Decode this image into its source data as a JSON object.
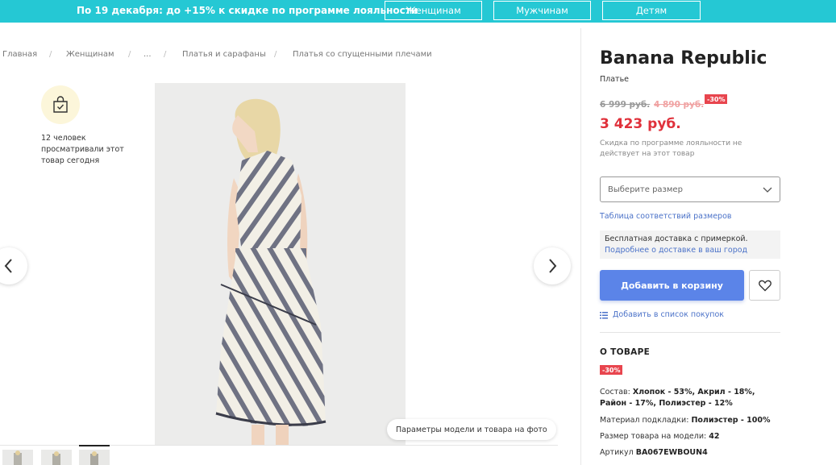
{
  "banner": {
    "promo": "По 19 декабря: до +15% к скидке по программе лояльности",
    "links": [
      "Женщинам",
      "Мужчинам",
      "Детям"
    ],
    "color": "#25c8d4"
  },
  "breadcrumb": [
    "Главная",
    "Женщинам",
    "...",
    "Платья и сарафаны",
    "Платья со спущенными плечами"
  ],
  "viewers": {
    "icon": "shopping-bag-check-icon",
    "text": "12 человек просматривали этот товар сегодня"
  },
  "gallery": {
    "photo_label": "Параметры модели и товара на фото",
    "thumbnail_count": 3,
    "active_thumbnail": 3
  },
  "product": {
    "brand": "Banana Republic",
    "category": "Платье",
    "price_original": "6 999 руб.",
    "price_previous": "4 890 руб.",
    "discount": "-30%",
    "price_current": "3 423 руб.",
    "loyalty_note": "Скидка по программе лояльности не действует на этот товар",
    "size_placeholder": "Выберите размер",
    "size_table_link": "Таблица соответствий размеров",
    "delivery_text": "Бесплатная доставка с примеркой.",
    "delivery_link": "Подробнее о доставке в ваш город",
    "add_to_cart": "Добавить в корзину",
    "add_to_list": "Добавить в список покупок",
    "accent_color": "#5b84e8",
    "price_color": "#e0313b"
  },
  "about": {
    "title": "О ТОВАРЕ",
    "badge": "-30%",
    "composition_label": "Состав:",
    "composition_value": "Хлопок - 53%, Акрил - 18%, Район - 17%, Полиэстер - 12%",
    "lining_label": "Материал подкладки:",
    "lining_value": "Полиэстер - 100%",
    "model_size_label": "Размер товара на модели:",
    "model_size_value": "42",
    "article_label": "Артикул",
    "article_value": "BA067EWBOUN4"
  }
}
